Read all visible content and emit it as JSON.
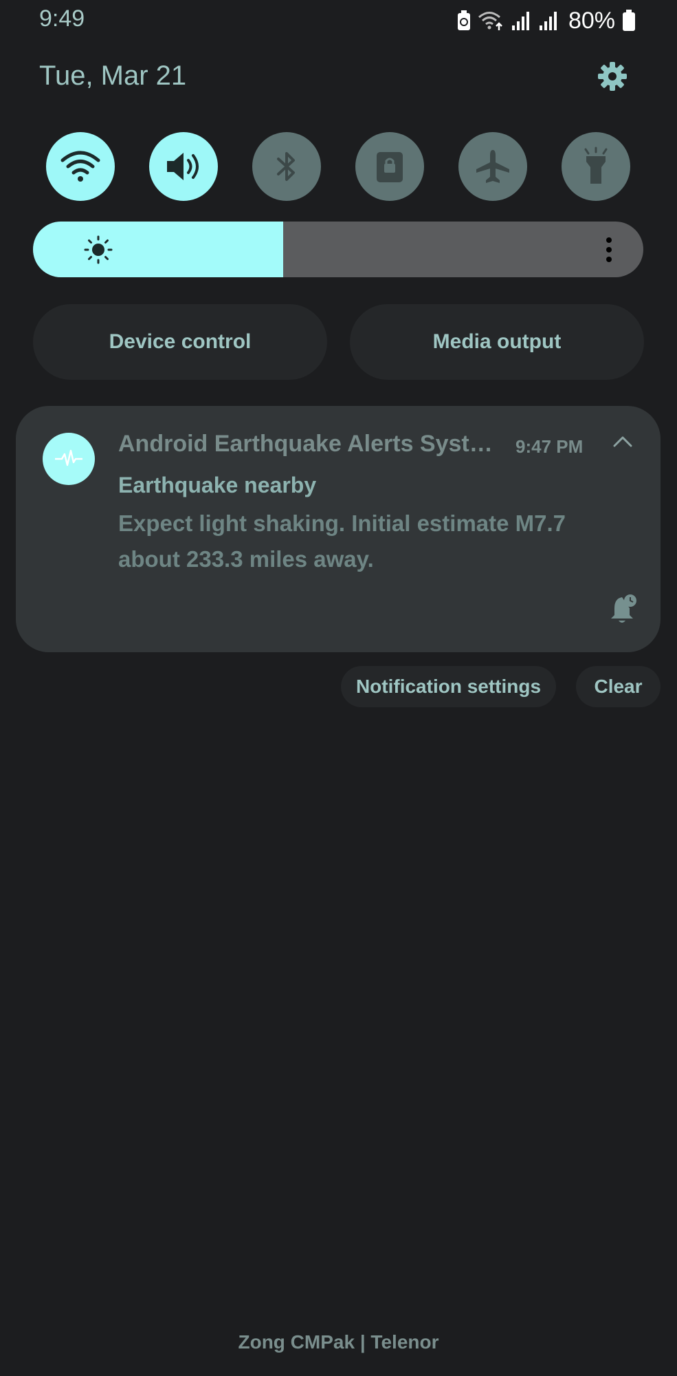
{
  "status_bar": {
    "time": "9:49",
    "battery_percent": "80%",
    "icons": [
      "battery-saver-icon",
      "wifi-calling-icon",
      "signal-sim1-icon",
      "signal-sim2-icon",
      "battery-icon"
    ]
  },
  "header": {
    "date": "Tue, Mar 21",
    "settings_icon": "gear-icon"
  },
  "quick_settings": {
    "tiles": [
      {
        "name": "wifi",
        "icon": "wifi-icon",
        "state": "on"
      },
      {
        "name": "sound",
        "icon": "volume-icon",
        "state": "on"
      },
      {
        "name": "bluetooth",
        "icon": "bluetooth-icon",
        "state": "off"
      },
      {
        "name": "auto-rotate",
        "icon": "rotation-lock-icon",
        "state": "off"
      },
      {
        "name": "airplane-mode",
        "icon": "airplane-icon",
        "state": "off"
      },
      {
        "name": "flashlight",
        "icon": "flashlight-icon",
        "state": "off"
      }
    ],
    "brightness_level": 0.41
  },
  "buttons": {
    "device_control": "Device control",
    "media_output": "Media output"
  },
  "notification": {
    "app_name": "Android Earthquake Alerts Syst…",
    "time": "9:47 PM",
    "title": "Earthquake nearby",
    "text": "Expect light shaking. Initial estimate M7.7 about 233.3 miles away."
  },
  "notification_actions": {
    "settings": "Notification settings",
    "clear": "Clear"
  },
  "footer": {
    "carrier": "Zong CMPak | Telenor"
  },
  "colors": {
    "accent": "#9ef8f8",
    "background": "#1c1d1f",
    "tile_off": "#5f7474",
    "card": "#323638"
  }
}
